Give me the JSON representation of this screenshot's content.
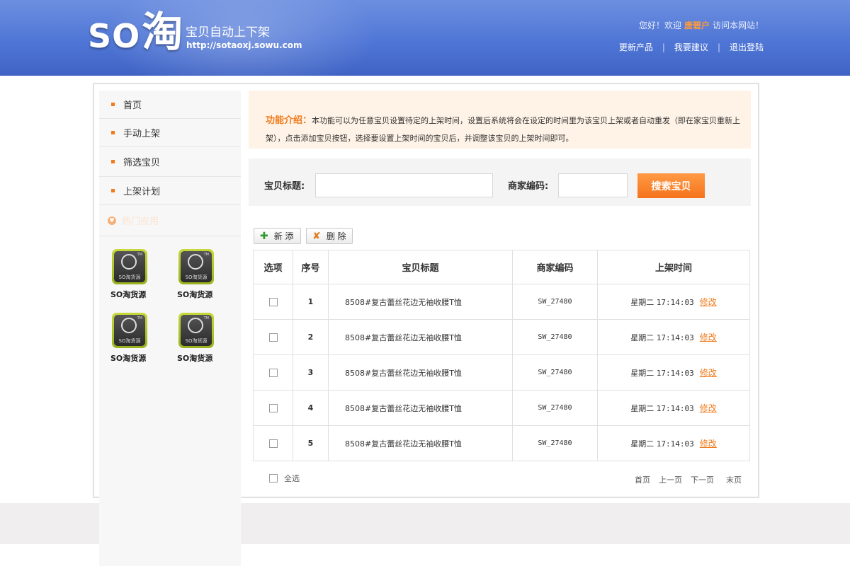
{
  "header": {
    "logo_so": "SO",
    "logo_tao": "淘",
    "slogan": "宝贝自动上下架",
    "url": "http://sotaoxj.sowu.com",
    "greet_prefix": "您好！欢迎",
    "user": "唐碧户",
    "greet_suffix": "访问本网站！",
    "links": [
      "更新产品",
      "我要建议",
      "退出登陆"
    ],
    "separator": "|"
  },
  "sidebar": {
    "items": [
      "首页",
      "手动上架",
      "筛选宝贝",
      "上架计划"
    ],
    "hot_label": "热门应用",
    "app_icon_caption": "SO淘货源",
    "app_icon_tm": "TM",
    "apps": [
      "SO淘货源",
      "SO淘货源",
      "SO淘货源",
      "SO淘货源"
    ]
  },
  "intro": {
    "title": "功能介绍：",
    "text": "本功能可以为任意宝贝设置待定的上架时间，设置后系统将会在设定的时间里为该宝贝上架或者自动重发（即在家宝贝重新上架），点击添加宝贝按钮，选择要设置上架时间的宝贝后，并调整该宝贝的上架时间即可。"
  },
  "search": {
    "title_label": "宝贝标题:",
    "title_value": "",
    "code_label": "商家编码:",
    "code_value": "",
    "button": "搜索宝贝"
  },
  "toolbar": {
    "add_icon": "✚",
    "add_label": "新 添",
    "delete_icon": "✘",
    "delete_label": "删 除"
  },
  "table": {
    "headers": [
      "选项",
      "序号",
      "宝贝标题",
      "商家编码",
      "上架时间"
    ],
    "rows": [
      {
        "idx": "1",
        "title": "8508#复古蕾丝花边无袖收腰T恤",
        "code": "SW_27480",
        "day": "星期二",
        "time": "17:14:03",
        "action": "修改"
      },
      {
        "idx": "2",
        "title": "8508#复古蕾丝花边无袖收腰T恤",
        "code": "SW_27480",
        "day": "星期二",
        "time": "17:14:03",
        "action": "修改"
      },
      {
        "idx": "3",
        "title": "8508#复古蕾丝花边无袖收腰T恤",
        "code": "SW_27480",
        "day": "星期二",
        "time": "17:14:03",
        "action": "修改"
      },
      {
        "idx": "4",
        "title": "8508#复古蕾丝花边无袖收腰T恤",
        "code": "SW_27480",
        "day": "星期二",
        "time": "17:14:03",
        "action": "修改"
      },
      {
        "idx": "5",
        "title": "8508#复古蕾丝花边无袖收腰T恤",
        "code": "SW_27480",
        "day": "星期二",
        "time": "17:14:03",
        "action": "修改"
      }
    ]
  },
  "footer": {
    "select_all": "全选",
    "pager": [
      "首页",
      "上一页",
      "下一页",
      "末页"
    ]
  }
}
